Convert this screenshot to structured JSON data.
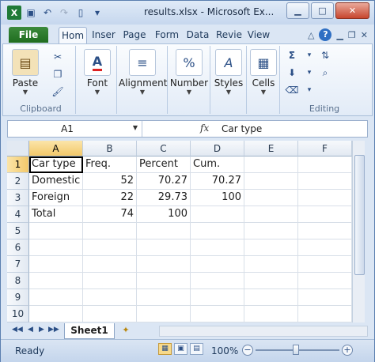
{
  "title": "results.xlsx - Microsoft Ex...",
  "quick_access": [
    "save-icon",
    "undo-icon",
    "redo-icon",
    "new-document-icon",
    "customize-icon"
  ],
  "tabs": [
    {
      "label": "File"
    },
    {
      "label": "Hom"
    },
    {
      "label": "Inser"
    },
    {
      "label": "Page"
    },
    {
      "label": "Form"
    },
    {
      "label": "Data"
    },
    {
      "label": "Revie"
    },
    {
      "label": "View"
    }
  ],
  "ribbon": {
    "clipboard": {
      "paste": "Paste",
      "label": "Clipboard"
    },
    "font": "Font",
    "alignment": "Alignment",
    "number": "Number",
    "styles": "Styles",
    "cells": "Cells",
    "editing": "Editing",
    "font_icon_text": "A",
    "number_icon_text": "%"
  },
  "formula_bar": {
    "name_box": "A1",
    "fx": "fx",
    "content": "Car type"
  },
  "grid": {
    "columns": [
      "A",
      "B",
      "C",
      "D",
      "E",
      "F"
    ],
    "rows": [
      "1",
      "2",
      "3",
      "4",
      "5",
      "6",
      "7",
      "8",
      "9",
      "10"
    ],
    "cells": [
      [
        "Car type",
        "Freq.",
        "Percent",
        "Cum.",
        "",
        ""
      ],
      [
        "Domestic",
        "52",
        "70.27",
        "70.27",
        "",
        ""
      ],
      [
        "Foreign",
        "22",
        "29.73",
        "100",
        "",
        ""
      ],
      [
        "Total",
        "74",
        "100",
        "",
        "",
        ""
      ]
    ]
  },
  "sheets": [
    {
      "label": "Sheet1"
    }
  ],
  "status": {
    "ready": "Ready",
    "zoom": "100%",
    "minus": "−",
    "plus": "+"
  },
  "accent": {
    "file_tab": "#2a7a2a",
    "selection": "#f5cf7a"
  }
}
